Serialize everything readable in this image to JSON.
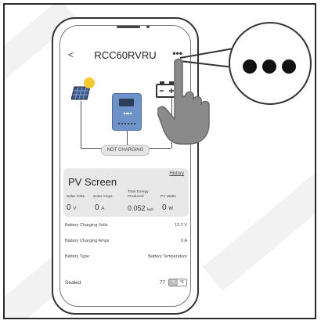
{
  "app": {
    "device_title": "RCC60RVRU",
    "back_icon": "chevron-left-icon",
    "more_icon": "more-horizontal-icon",
    "more_label": "•••"
  },
  "diagram": {
    "status": "NOT CHARGING"
  },
  "pv_screen": {
    "title": "PV Screen",
    "history_link": "History",
    "metrics": [
      {
        "label": "Solar Volts",
        "value": "0",
        "unit": "V"
      },
      {
        "label": "Solar Amps",
        "value": "0",
        "unit": "A"
      },
      {
        "label": "Total Energy Produced",
        "value": "0.052",
        "unit": "kwh"
      },
      {
        "label": "PV Watts",
        "value": "0",
        "unit": "W"
      }
    ]
  },
  "battery": {
    "rows": [
      {
        "label": "Battery Charging Volts",
        "value": "13.2 V"
      },
      {
        "label": "Battery Charging Amps",
        "value": "0 A"
      },
      {
        "label": "Battery Type",
        "value": "Battery Temperature"
      }
    ],
    "type_value": "Sealed",
    "temperature_value": "77",
    "unit_c": "°C",
    "unit_f": "°F"
  },
  "callout": {
    "label": "•••"
  },
  "colors": {
    "controller": "#6e93c8",
    "sun": "#f6c934",
    "card_bg": "#e8e8e8"
  }
}
